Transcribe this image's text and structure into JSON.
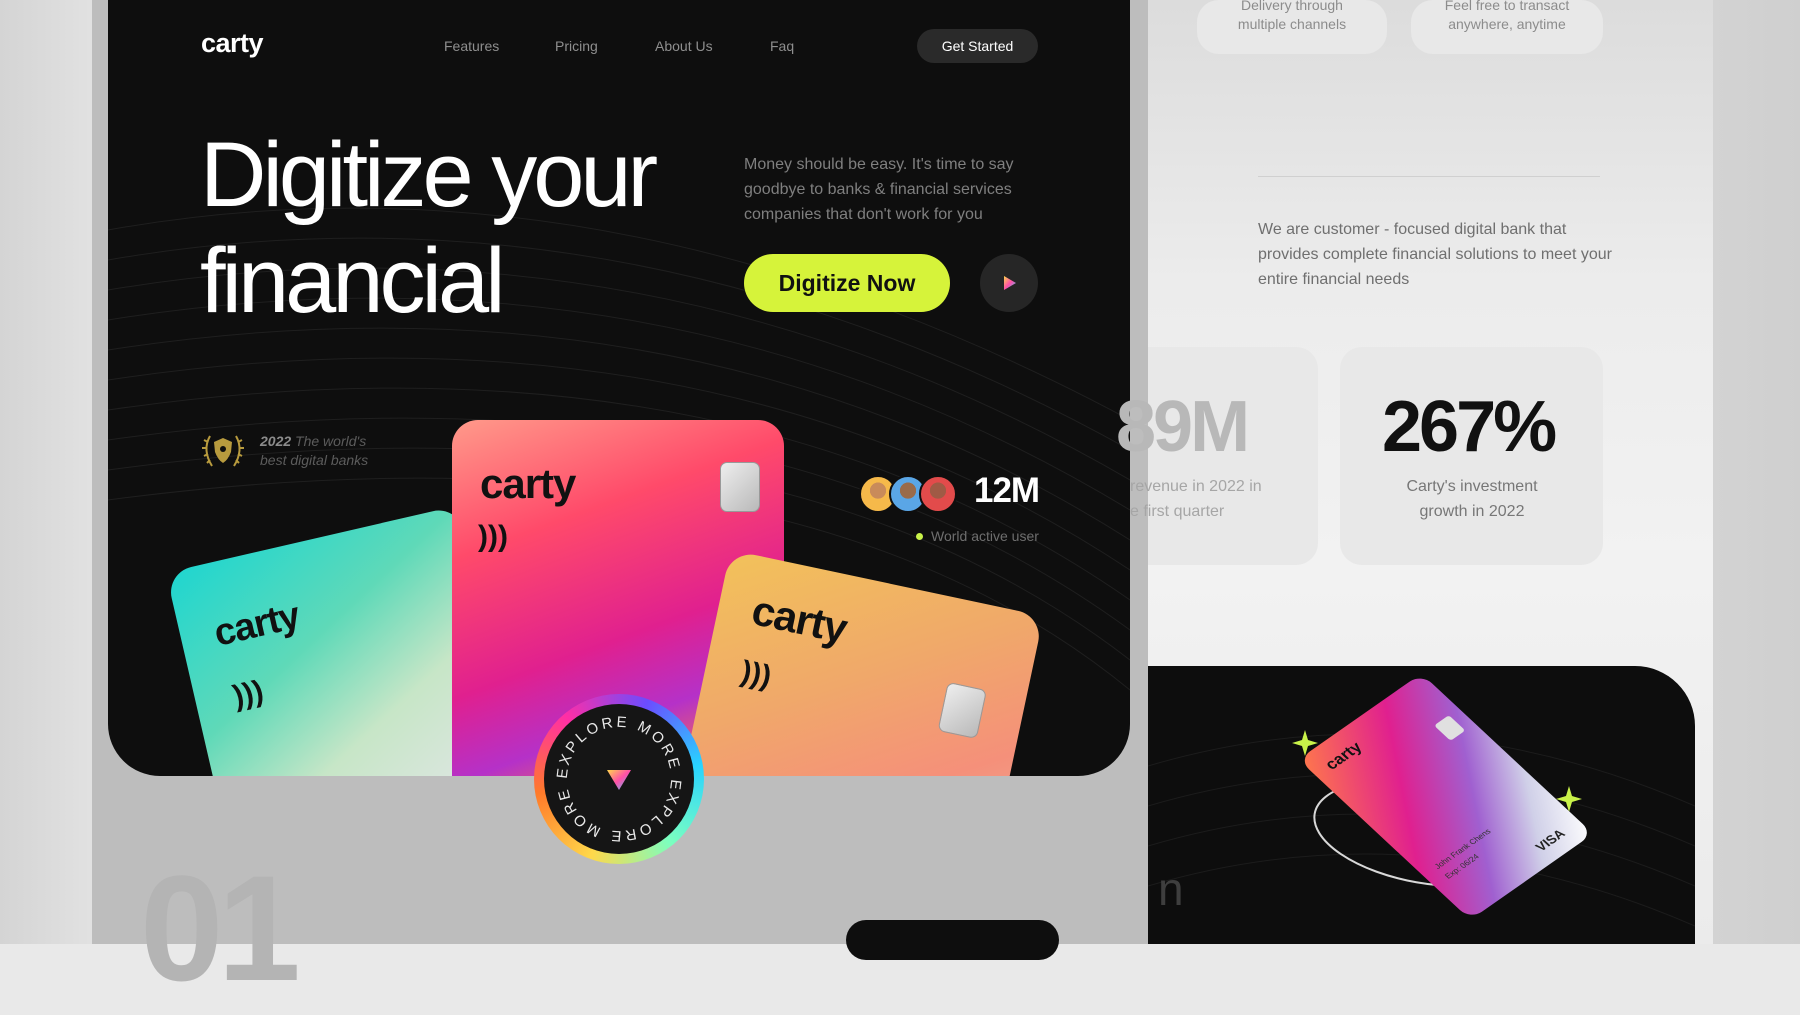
{
  "brand": {
    "name": "carty",
    "accent": "#d6f33a"
  },
  "nav": {
    "items": [
      "Features",
      "Pricing",
      "About Us",
      "Faq"
    ],
    "cta": "Get Started"
  },
  "hero": {
    "headline_line1": "Digitize your",
    "headline_line2": "financial",
    "subtext": "Money should be easy. It's time to say goodbye to banks & financial services companies that don't work for you",
    "primary_button": "Digitize Now",
    "play_icon": "play-icon"
  },
  "award": {
    "year": "2022",
    "text": "The world's",
    "text2": "best digital banks"
  },
  "users": {
    "count": "12M",
    "label": "World active user"
  },
  "cards": {
    "label": "carty"
  },
  "explore": {
    "label": "EXPLORE MORE"
  },
  "right": {
    "tile1_text": "Delivery through multiple channels",
    "tile2_text": "Feel free to transact anywhere, anytime",
    "about": "We are  customer - focused digital bank that provides complete financial solutions to meet your entire financial needs",
    "stat1_value": "89M",
    "stat1_label_l1": "revenue in 2022 in",
    "stat1_label_l2": "e first quarter",
    "stat2_value": "267%",
    "stat2_label_l1": "Carty's investment",
    "stat2_label_l2": "growth in 2022",
    "card_brand": "carty",
    "card_name": "John Frank Chens",
    "card_exp": "Exp: 06/24",
    "card_network": "VISA",
    "ghost_text": "n"
  },
  "ghost_number": "01"
}
